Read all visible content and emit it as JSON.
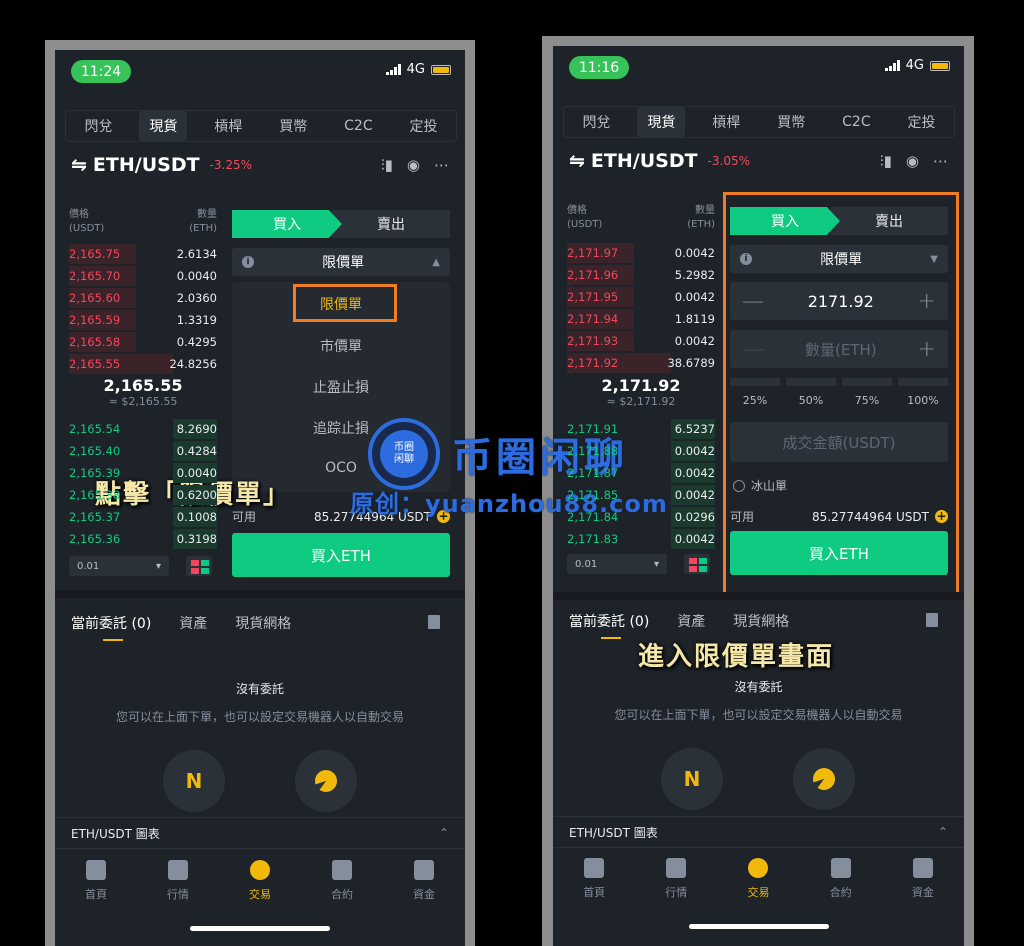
{
  "phones": [
    {
      "time": "11:24",
      "network": "4G",
      "tabs": [
        "閃兌",
        "現貨",
        "槓桿",
        "買幣",
        "C2C",
        "定投"
      ],
      "active_tab": "現貨",
      "pair": "ETH/USDT",
      "change": "-3.25%",
      "ob_head": {
        "price": "價格",
        "price_unit": "(USDT)",
        "qty": "數量",
        "qty_unit": "(ETH)"
      },
      "asks": [
        {
          "p": "2,165.75",
          "q": "2.6134",
          "depth": 0.45
        },
        {
          "p": "2,165.70",
          "q": "0.0040",
          "depth": 0.45
        },
        {
          "p": "2,165.60",
          "q": "2.0360",
          "depth": 0.45
        },
        {
          "p": "2,165.59",
          "q": "1.3319",
          "depth": 0.45
        },
        {
          "p": "2,165.58",
          "q": "0.4295",
          "depth": 0.45
        },
        {
          "p": "2,165.55",
          "q": "24.8256",
          "depth": 0.7
        }
      ],
      "mid_price": "2,165.55",
      "mid_fiat": "≈ $2,165.55",
      "bids": [
        {
          "p": "2,165.54",
          "q": "8.2690",
          "depth": 0.3
        },
        {
          "p": "2,165.40",
          "q": "0.4284",
          "depth": 0.3
        },
        {
          "p": "2,165.39",
          "q": "0.0040",
          "depth": 0.3
        },
        {
          "p": "2,165.38",
          "q": "0.6200",
          "depth": 0.3
        },
        {
          "p": "2,165.37",
          "q": "0.1008",
          "depth": 0.3
        },
        {
          "p": "2,165.36",
          "q": "0.3198",
          "depth": 0.3
        }
      ],
      "depth_select": "0.01",
      "buy_label": "買入",
      "sell_label": "賣出",
      "order_type": "限價單",
      "dropdown": [
        "限價單",
        "市價單",
        "止盈止損",
        "追踪止損",
        "OCO"
      ],
      "available_label": "可用",
      "available_amount": "85.27744964 USDT",
      "buy_button": "買入ETH",
      "order_tabs": [
        "當前委託 (0)",
        "資產",
        "現貨網格"
      ],
      "empty_title": "沒有委託",
      "empty_sub": "您可以在上面下單，也可以設定交易機器人以自動交易",
      "chart_label": "ETH/USDT 圖表",
      "nav": [
        "首頁",
        "行情",
        "交易",
        "合約",
        "資金"
      ],
      "nav_active": "交易",
      "overlay": "點擊「限價單」"
    },
    {
      "time": "11:16",
      "network": "4G",
      "tabs": [
        "閃兌",
        "現貨",
        "槓桿",
        "買幣",
        "C2C",
        "定投"
      ],
      "active_tab": "現貨",
      "pair": "ETH/USDT",
      "change": "-3.05%",
      "ob_head": {
        "price": "價格",
        "price_unit": "(USDT)",
        "qty": "數量",
        "qty_unit": "(ETH)"
      },
      "asks": [
        {
          "p": "2,171.97",
          "q": "0.0042",
          "depth": 0.45
        },
        {
          "p": "2,171.96",
          "q": "5.2982",
          "depth": 0.45
        },
        {
          "p": "2,171.95",
          "q": "0.0042",
          "depth": 0.45
        },
        {
          "p": "2,171.94",
          "q": "1.8119",
          "depth": 0.45
        },
        {
          "p": "2,171.93",
          "q": "0.0042",
          "depth": 0.45
        },
        {
          "p": "2,171.92",
          "q": "38.6789",
          "depth": 0.7
        }
      ],
      "mid_price": "2,171.92",
      "mid_fiat": "≈ $2,171.92",
      "bids": [
        {
          "p": "2,171.91",
          "q": "6.5237",
          "depth": 0.3
        },
        {
          "p": "2,171.88",
          "q": "0.0042",
          "depth": 0.3
        },
        {
          "p": "2,171.87",
          "q": "0.0042",
          "depth": 0.3
        },
        {
          "p": "2,171.85",
          "q": "0.0042",
          "depth": 0.3
        },
        {
          "p": "2,171.84",
          "q": "0.0296",
          "depth": 0.3
        },
        {
          "p": "2,171.83",
          "q": "0.0042",
          "depth": 0.3
        }
      ],
      "depth_select": "0.01",
      "buy_label": "買入",
      "sell_label": "賣出",
      "order_type": "限價單",
      "price_value": "2171.92",
      "qty_placeholder": "數量(ETH)",
      "percents": [
        "25%",
        "50%",
        "75%",
        "100%"
      ],
      "total_placeholder": "成交金額(USDT)",
      "iceberg": "冰山單",
      "available_label": "可用",
      "available_amount": "85.27744964 USDT",
      "buy_button": "買入ETH",
      "order_tabs": [
        "當前委託 (0)",
        "資產",
        "現貨網格"
      ],
      "empty_title": "沒有委託",
      "empty_sub": "您可以在上面下單，也可以設定交易機器人以自動交易",
      "chart_label": "ETH/USDT 圖表",
      "nav": [
        "首頁",
        "行情",
        "交易",
        "合約",
        "資金"
      ],
      "nav_active": "交易",
      "overlay": "進入限價單畫面"
    }
  ],
  "watermark": {
    "title": "币圈闲聊",
    "sub": "原创：yuanzhou88.com",
    "badge": "币圈\n闲聊"
  },
  "colors": {
    "bg": "#1e2329",
    "buy": "#0ecb81",
    "sell": "#f6465d",
    "accent": "#f0b90b",
    "highlight": "#f07d24",
    "watermark": "#2d6cdf"
  }
}
